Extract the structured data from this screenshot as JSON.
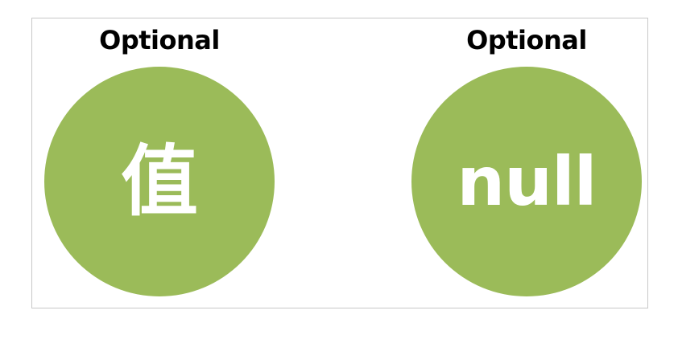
{
  "colors": {
    "circle_fill": "#9bbb59",
    "circle_text": "#ffffff",
    "frame_border": "#c8c8c8"
  },
  "panels": [
    {
      "label": "Optional",
      "circle_text": "值"
    },
    {
      "label": "Optional",
      "circle_text": "null"
    }
  ]
}
